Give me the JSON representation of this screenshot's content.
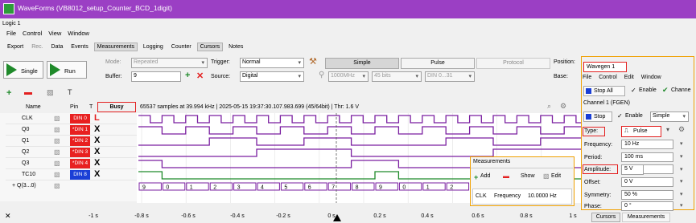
{
  "window": {
    "title": "WaveForms (VB8012_setup_Counter_BCD_1digit)"
  },
  "subtitle": "Logic 1",
  "menu": [
    "File",
    "Control",
    "View",
    "Window"
  ],
  "tabs": [
    "Export",
    "Rec.",
    "Data",
    "Events",
    "Measurements",
    "Logging",
    "Counter",
    "Cursors",
    "Notes"
  ],
  "toolbar": {
    "single_label": "Single",
    "run_label": "Run",
    "mode_label": "Mode:",
    "mode_value": "Repeated",
    "buffer_label": "Buffer:",
    "buffer_value": "9",
    "trigger_label": "Trigger:",
    "trigger_value": "Normal",
    "source_label": "Source:",
    "source_value": "Digital",
    "simple_label": "Simple",
    "pulse_label": "Pulse",
    "protocol_label": "Protocol",
    "position_label": "Position:",
    "base_label": "Base:",
    "rate_value": "1000MHz",
    "bits_value": "45 bits",
    "din_value": "DIN 0...31"
  },
  "columns": {
    "name": "Name",
    "pin": "Pin",
    "t": "T"
  },
  "status": {
    "busy": "Busy",
    "info": "65537 samples at 39.994 kHz | 2025-05-15 19:37:30.107.983.699 (45/64bit) | Thr: 1.6 V"
  },
  "signals": [
    {
      "name": "CLK",
      "pin": "DIN 0",
      "color": "#e82020"
    },
    {
      "name": "Q0",
      "pin": "*DIN 1",
      "color": "#e82020"
    },
    {
      "name": "Q1",
      "pin": "*DIN 2",
      "color": "#e82020"
    },
    {
      "name": "Q2",
      "pin": "*DIN 3",
      "color": "#e82020"
    },
    {
      "name": "Q3",
      "pin": "*DIN 4",
      "color": "#e82020"
    },
    {
      "name": "TC10",
      "pin": "DIN 8",
      "color": "#1a3fd6"
    }
  ],
  "bus": {
    "name": "+ Q(3...0)",
    "values": [
      "9",
      "0",
      "1",
      "2",
      "3",
      "4",
      "5",
      "6",
      "7",
      "8",
      "9",
      "0",
      "1",
      "2"
    ]
  },
  "time_axis": [
    "-1 s",
    "-0.8 s",
    "-0.6 s",
    "-0.4 s",
    "-0.2 s",
    "0 s",
    "0.2 s",
    "0.4 s",
    "0.6 s",
    "0.8 s",
    "1 s"
  ],
  "measurements": {
    "title": "Measurements",
    "add": "Add",
    "show": "Show",
    "edit": "Edit",
    "row": {
      "name": "CLK",
      "type": "Frequency",
      "value": "10.0000 Hz"
    }
  },
  "wavegen": {
    "title": "Wavegen 1",
    "menu": [
      "File",
      "Control",
      "Edit",
      "Window"
    ],
    "stop_all": "Stop All",
    "enable": "Enable",
    "channel2": "Channe",
    "channel_title": "Channel 1 (FGEN)",
    "stop": "Stop",
    "enable2": "Enable",
    "simple": "Simple",
    "type_label": "Type:",
    "type_value": "Pulse",
    "frequency_label": "Frequency:",
    "frequency_value": "10 Hz",
    "period_label": "Period:",
    "period_value": "100 ms",
    "amplitude_label": "Amplitude:",
    "amplitude_value": "5 V",
    "offset_label": "Offset:",
    "offset_value": "0 V",
    "symmetry_label": "Symmetry:",
    "symmetry_value": "50 %",
    "phase_label": "Phase:",
    "phase_value": "0 °",
    "tabs": [
      "Cursors",
      "Measurements"
    ]
  },
  "colors": {
    "titlebar": "#9b3fc4",
    "digital": "#7a1fa0",
    "tc10": "#1f8a2a",
    "highlight": "#e32020",
    "outline": "#f0a000"
  }
}
